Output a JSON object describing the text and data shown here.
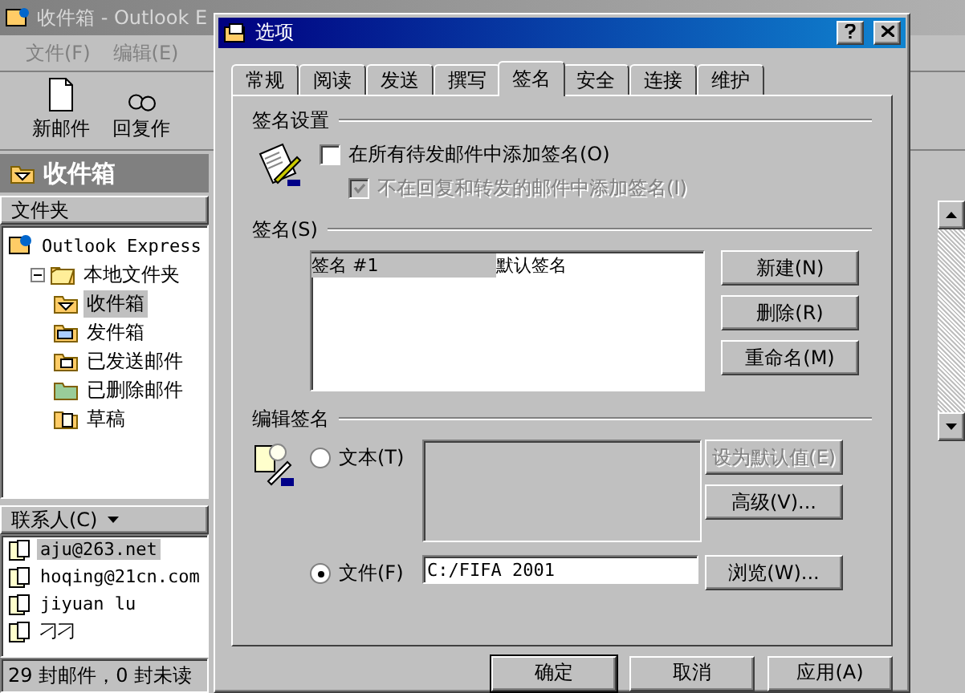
{
  "main": {
    "title": "收件箱 - Outlook E",
    "menu": [
      {
        "label": "文件(F)"
      },
      {
        "label": "编辑(E)"
      }
    ],
    "toolbar": [
      {
        "label": "新邮件",
        "kind": "new"
      },
      {
        "label": "回复作",
        "kind": "reply"
      }
    ],
    "header": "收件箱",
    "folders_title": "文件夹",
    "tree": [
      {
        "label": "Outlook Express",
        "kind": "root",
        "selected": false,
        "children": [
          {
            "label": "本地文件夹",
            "kind": "local",
            "selected": false,
            "expanded": true,
            "children": [
              {
                "label": "收件箱",
                "kind": "inbox",
                "selected": true
              },
              {
                "label": "发件箱",
                "kind": "outbox",
                "selected": false
              },
              {
                "label": "已发送邮件",
                "kind": "sent",
                "selected": false
              },
              {
                "label": "已删除邮件",
                "kind": "deleted",
                "selected": false
              },
              {
                "label": "草稿",
                "kind": "drafts",
                "selected": false
              }
            ]
          }
        ]
      }
    ],
    "contacts_title": "联系人(C)",
    "contacts": [
      {
        "name": "aju@263.net",
        "selected": true
      },
      {
        "name": "hoqing@21cn.com",
        "selected": false
      },
      {
        "name": "jiyuan lu",
        "selected": false
      },
      {
        "name": "刁刁",
        "selected": false
      }
    ],
    "status": "29 封邮件，0 封未读"
  },
  "dialog": {
    "title": "选项",
    "tabs": [
      {
        "label": "常规",
        "selected": false
      },
      {
        "label": "阅读",
        "selected": false
      },
      {
        "label": "发送",
        "selected": false
      },
      {
        "label": "撰写",
        "selected": false
      },
      {
        "label": "签名",
        "selected": true
      },
      {
        "label": "安全",
        "selected": false
      },
      {
        "label": "连接",
        "selected": false
      },
      {
        "label": "维护",
        "selected": false
      }
    ],
    "settings": {
      "title": "签名设置",
      "options": [
        {
          "label": "在所有待发邮件中添加签名(O)",
          "checked": false,
          "disabled": false
        },
        {
          "label": "不在回复和转发的邮件中添加签名(I)",
          "checked": true,
          "disabled": true
        }
      ]
    },
    "signatures": {
      "title": "签名(S)",
      "rows": [
        {
          "name": "签名 #1",
          "note": "默认签名",
          "selected": true
        }
      ],
      "buttons": [
        {
          "label": "新建(N)",
          "disabled": false
        },
        {
          "label": "删除(R)",
          "disabled": false
        },
        {
          "label": "重命名(M)",
          "disabled": false
        }
      ]
    },
    "edit": {
      "title": "编辑签名",
      "text_option": {
        "label": "文本(T)",
        "selected": false
      },
      "file_option": {
        "label": "文件(F)",
        "selected": true
      },
      "file_value": "C:/FIFA 2001",
      "side_buttons": [
        {
          "label": "设为默认值(E)",
          "disabled": true
        },
        {
          "label": "高级(V)...",
          "disabled": false
        }
      ],
      "browse": {
        "label": "浏览(W)...",
        "disabled": false
      }
    },
    "footer": [
      {
        "label": "确定",
        "default": true
      },
      {
        "label": "取消",
        "default": false
      },
      {
        "label": "应用(A)",
        "default": false
      }
    ]
  }
}
